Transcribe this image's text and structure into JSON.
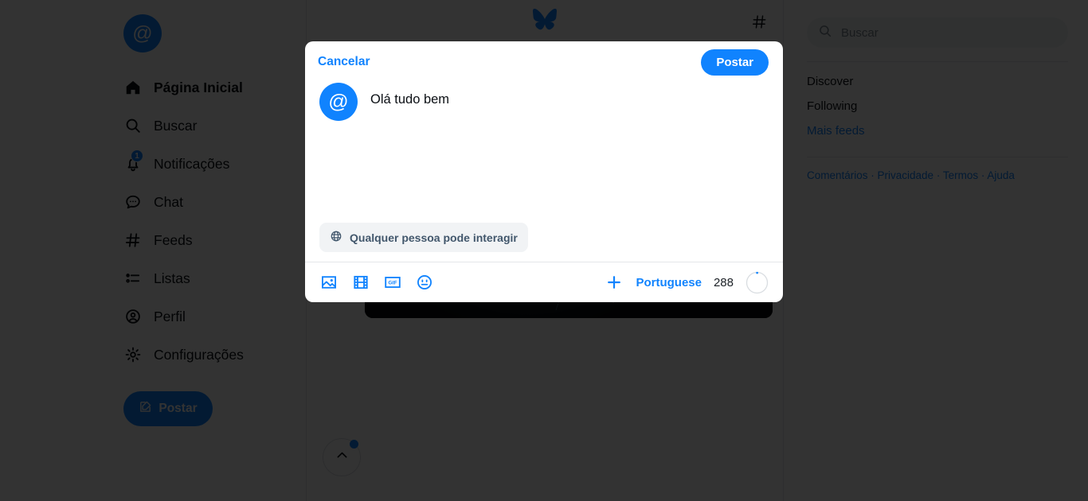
{
  "colors": {
    "accent": "#1083fe",
    "text": "#0b0f14",
    "muted": "#566370",
    "chip_bg": "#f1f3f5",
    "overlay": "rgba(0,0,0,0.80)",
    "border": "#e4e6e9"
  },
  "sidebar": {
    "avatar_glyph": "@",
    "avatar_icon": "at-sign-avatar",
    "items": [
      {
        "label": "Página Inicial",
        "icon": "home-icon",
        "active": true,
        "badge": ""
      },
      {
        "label": "Buscar",
        "icon": "search-icon",
        "active": false,
        "badge": ""
      },
      {
        "label": "Notificações",
        "icon": "bell-icon",
        "active": false,
        "badge": "1"
      },
      {
        "label": "Chat",
        "icon": "chat-bubble-icon",
        "active": false,
        "badge": ""
      },
      {
        "label": "Feeds",
        "icon": "hash-icon",
        "active": false,
        "badge": ""
      },
      {
        "label": "Listas",
        "icon": "list-icon",
        "active": false,
        "badge": ""
      },
      {
        "label": "Perfil",
        "icon": "user-circle-icon",
        "active": false,
        "badge": ""
      },
      {
        "label": "Configurações",
        "icon": "gear-icon",
        "active": false,
        "badge": ""
      }
    ],
    "post_button": "Postar"
  },
  "center": {
    "logo_icon": "bluesky-butterfly-logo",
    "feeds_icon": "hash-icon",
    "post": {
      "image_alt": "nebula-photo",
      "scroll_top_icon": "chevron-up-icon"
    }
  },
  "right": {
    "search": {
      "placeholder": "Buscar",
      "icon": "search-icon"
    },
    "links": [
      {
        "label": "Discover",
        "blue": false
      },
      {
        "label": "Following",
        "blue": false
      },
      {
        "label": "Mais feeds",
        "blue": true
      }
    ],
    "footer": {
      "comentarios": "Comentários",
      "privacidade": "Privacidade",
      "termos": "Termos",
      "ajuda": "Ajuda",
      "separator": " · "
    }
  },
  "composer": {
    "cancel_label": "Cancelar",
    "post_label": "Postar",
    "avatar_glyph": "@",
    "text_value": "Olá tudo bem",
    "interaction_chip": {
      "label": "Qualquer pessoa pode interagir",
      "icon": "globe-icon"
    },
    "toolbar": {
      "image_icon": "image-icon",
      "video_icon": "video-film-icon",
      "gif_icon": "gif-icon",
      "emoji_icon": "emoji-smiley-icon",
      "add_icon": "plus-icon",
      "language_label": "Portuguese",
      "char_remaining": "288"
    }
  }
}
